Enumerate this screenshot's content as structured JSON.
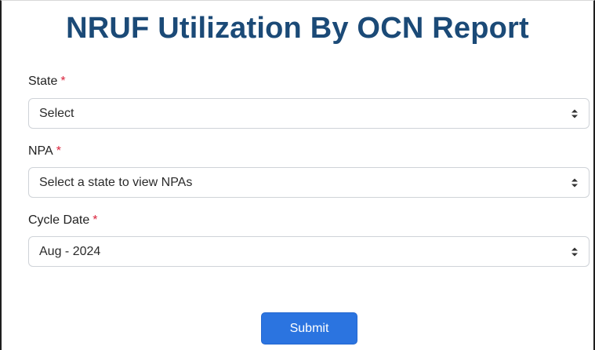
{
  "page": {
    "title": "NRUF Utilization By OCN Report"
  },
  "form": {
    "required_marker": "*",
    "state": {
      "label": "State",
      "value": "Select"
    },
    "npa": {
      "label": "NPA",
      "value": "Select a state to view NPAs"
    },
    "cycle_date": {
      "label": "Cycle Date",
      "value": "Aug - 2024"
    },
    "submit_label": "Submit"
  },
  "colors": {
    "title": "#1b4a77",
    "required": "#d9233c",
    "button": "#2b74e0",
    "border": "#cfd3d8"
  },
  "icons": {
    "select_arrow": "chevron-up-down-icon"
  }
}
